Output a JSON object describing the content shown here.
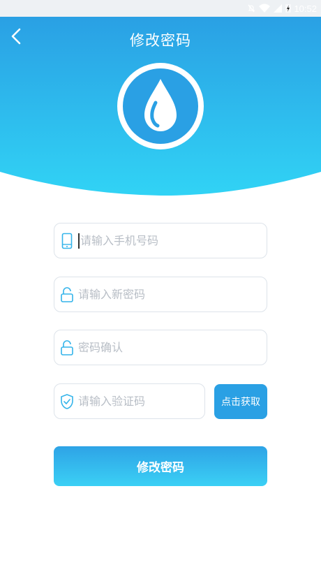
{
  "status_bar": {
    "time": "10:52",
    "icons": [
      "mute-icon",
      "wifi-icon",
      "signal-icon",
      "battery-charging-icon"
    ]
  },
  "header": {
    "title": "修改密码",
    "back_icon": "back-arrow-icon",
    "logo_icon": "water-drop-icon"
  },
  "form": {
    "phone_placeholder": "请输入手机号码",
    "new_password_placeholder": "请输入新密码",
    "confirm_password_placeholder": "密码确认",
    "code_placeholder": "请输入验证码",
    "get_code_label": "点击获取",
    "submit_label": "修改密码"
  },
  "colors": {
    "header_top": "#2aa0e4",
    "header_bottom": "#31d3f5",
    "icon_blue": "#34b4ea",
    "button_blue": "#2aa0e4",
    "placeholder": "#b8bec6"
  }
}
